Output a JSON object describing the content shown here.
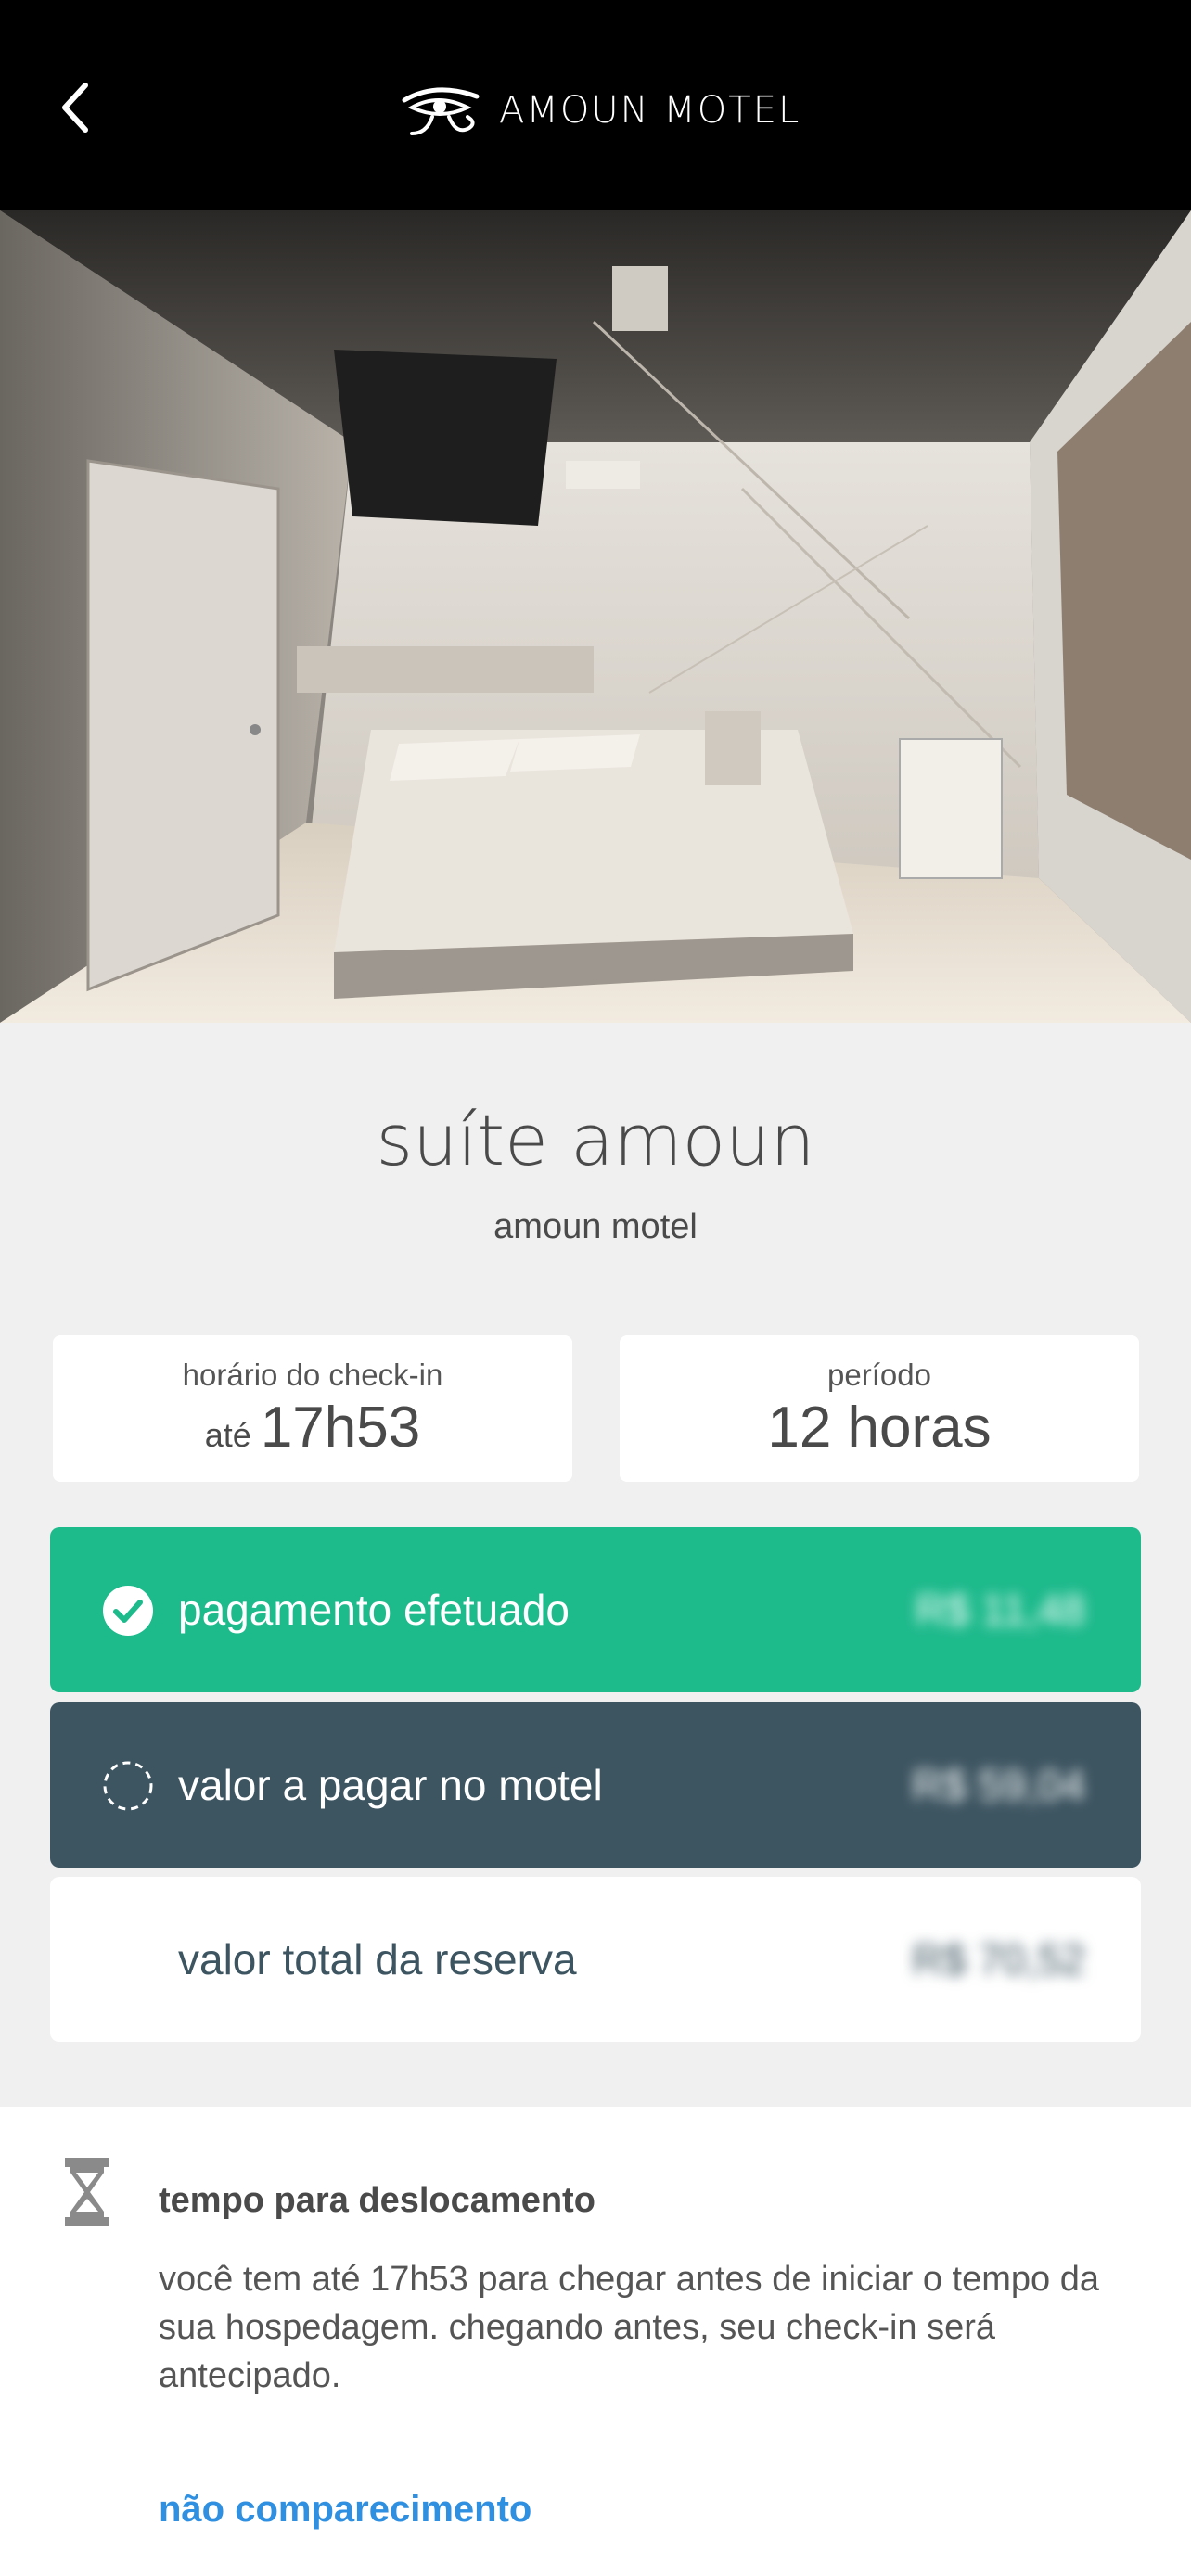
{
  "header": {
    "logo_text": "AMOUN MOTEL",
    "back_icon": "chevron-left-icon",
    "logo_icon": "eye-of-horus-icon"
  },
  "suite": {
    "title": "suíte amoun",
    "motel": "amoun motel"
  },
  "checkin": {
    "label": "horário do check-in",
    "prefix": "até",
    "time": "17h53"
  },
  "period": {
    "label": "período",
    "value": "12 horas"
  },
  "payments": {
    "paid_label": "pagamento efetuado",
    "paid_amount": "R$ 11,48",
    "paid_icon": "check-circle-icon",
    "due_label": "valor a pagar no motel",
    "due_amount": "R$ 59,04",
    "due_icon": "dashed-circle-icon",
    "total_label": "valor total da reserva",
    "total_amount": "R$ 70,52"
  },
  "travel": {
    "icon": "hourglass-icon",
    "title": "tempo para deslocamento",
    "body": "você tem até 17h53 para chegar antes de iniciar o tempo da sua hospedagem. chegando antes, seu check-in será antecipado.",
    "noshow_link": "não comparecimento"
  },
  "colors": {
    "paid_green": "#1dba8c",
    "due_slate": "#3d5561",
    "link_blue": "#2f8fe0"
  }
}
